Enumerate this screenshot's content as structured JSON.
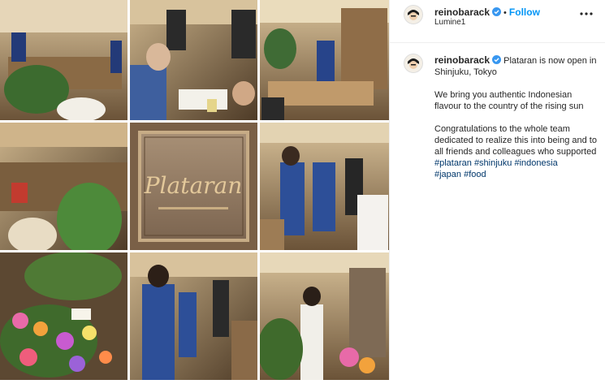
{
  "post": {
    "username": "reinobarack",
    "follow_label": "Follow",
    "location": "Lumine1",
    "caption_lines": [
      "Plataran is now open in Shinjuku, Tokyo",
      "We bring you authentic Indonesian flavour to the country of the rising sun",
      "Congratulations to the whole team dedicated to realize this into being and to all friends and colleagues who supported"
    ],
    "hashtags": [
      "#plataran",
      "#shinjuku",
      "#indonesia",
      "#japan",
      "#food"
    ],
    "sign_text": "Plataran"
  },
  "colors": {
    "follow": "#0095f6",
    "hashtag": "#00376b",
    "verified": "#3897f0"
  },
  "icons": {
    "verified": "verified-badge-icon",
    "more": "more-options-icon"
  }
}
